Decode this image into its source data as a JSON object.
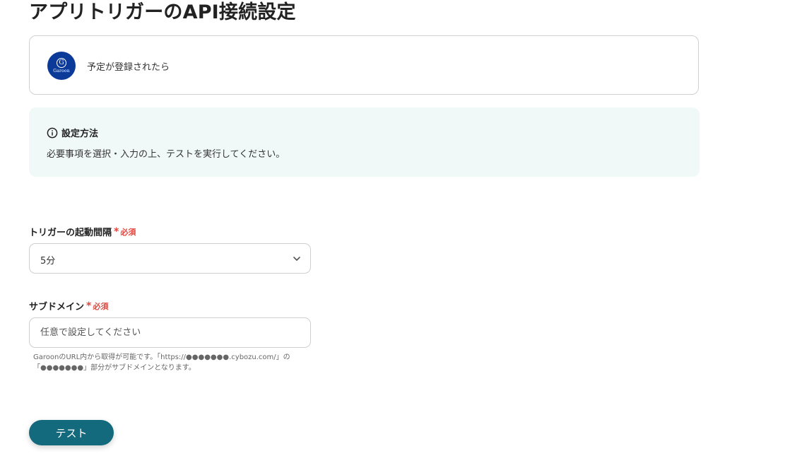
{
  "page": {
    "title": "アプリトリガーのAPI接続設定"
  },
  "app_card": {
    "logo_letter": "G",
    "logo_text": "Garoon",
    "trigger_name": "予定が登録されたら"
  },
  "info": {
    "title": "設定方法",
    "text": "必要事項を選択・入力の上、テストを実行してください。"
  },
  "form": {
    "interval": {
      "label": "トリガーの起動間隔",
      "required_mark": "*",
      "required_text": "必須",
      "value": "5分"
    },
    "subdomain": {
      "label": "サブドメイン",
      "required_mark": "*",
      "required_text": "必須",
      "placeholder": "任意で設定してください",
      "help": "GaroonのURL内から取得が可能です。「https://●●●●●●●.cybozu.com/」の「●●●●●●●」部分がサブドメインとなります。"
    }
  },
  "actions": {
    "test_label": "テスト"
  },
  "colors": {
    "primary_button": "#136a7c",
    "required": "#e0473f",
    "info_background": "#f1f9f8",
    "garoon_logo": "#0b3a99"
  },
  "icons": {
    "info": "info-circle-icon",
    "select": "chevron-down-icon"
  }
}
